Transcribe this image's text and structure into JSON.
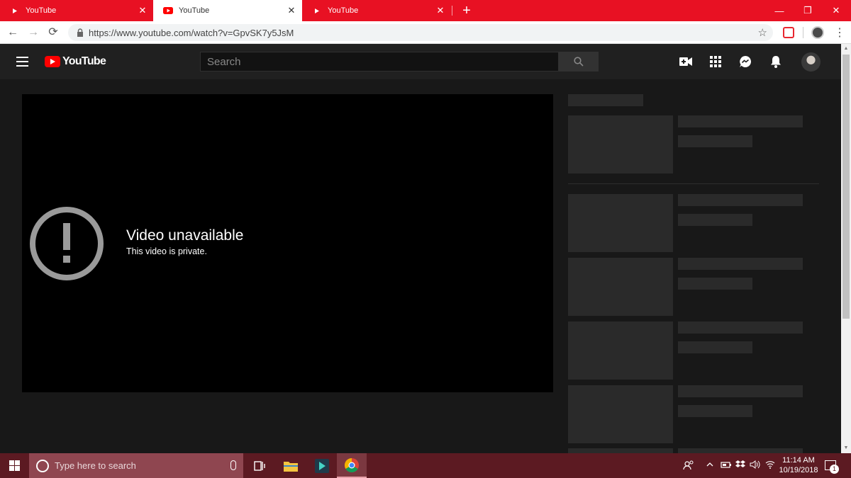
{
  "browser": {
    "tabs": [
      {
        "title": "YouTube",
        "active": false
      },
      {
        "title": "YouTube",
        "active": true
      },
      {
        "title": "YouTube",
        "active": false
      }
    ],
    "new_tab_glyph": "+",
    "close_glyph": "✕",
    "window_controls": {
      "minimize": "—",
      "restore": "❐",
      "close": "✕"
    },
    "url": "https://www.youtube.com/watch?v=GpvSK7y5JsM",
    "back_glyph": "←",
    "forward_glyph": "→",
    "reload_glyph": "⟳",
    "star_glyph": "☆",
    "menu_glyph": "⋮"
  },
  "youtube": {
    "logo_text": "YouTube",
    "search_placeholder": "Search",
    "player": {
      "error_title": "Video unavailable",
      "error_subtitle": "This video is private."
    },
    "icons": [
      "menu-icon",
      "youtube-logo",
      "search-icon",
      "create-video-icon",
      "apps-icon",
      "messages-icon",
      "notifications-icon",
      "avatar"
    ],
    "brand_color": "#ff0000",
    "background_color": "#181818",
    "skeleton_color": "#2a2a2a"
  },
  "taskbar": {
    "search_placeholder": "Type here to search",
    "time": "11:14 AM",
    "date": "10/19/2018",
    "notification_count": "1",
    "accent_color": "#5c1a22"
  }
}
